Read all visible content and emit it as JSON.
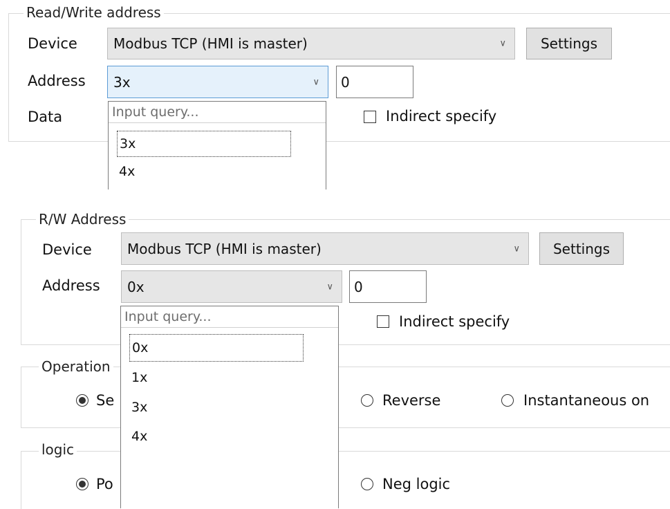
{
  "panel_top": {
    "legend": "Read/Write address",
    "device_label": "Device",
    "device_value": "Modbus TCP (HMI is master)",
    "settings_label": "Settings",
    "address_label": "Address",
    "address_type": "3x",
    "address_value": "0",
    "data_label": "Data",
    "indirect_label": "Indirect specify",
    "dropdown": {
      "query_placeholder": "Input query...",
      "items": [
        "3x",
        "4x"
      ],
      "selected": "3x"
    }
  },
  "panel_bottom": {
    "legend": "R/W Address",
    "device_label": "Device",
    "device_value": "Modbus TCP (HMI is master)",
    "settings_label": "Settings",
    "address_label": "Address",
    "address_type": "0x",
    "address_value": "0",
    "indirect_label": "Indirect specify",
    "dropdown": {
      "query_placeholder": "Input query...",
      "items": [
        "0x",
        "1x",
        "3x",
        "4x"
      ],
      "selected": "0x"
    },
    "operation": {
      "legend": "Operation",
      "options": [
        "Se",
        "Reverse",
        "Instantaneous on"
      ],
      "selected": "Se"
    },
    "logic": {
      "legend": "logic",
      "options": [
        "Po",
        "Neg logic"
      ],
      "selected": "Po"
    }
  }
}
